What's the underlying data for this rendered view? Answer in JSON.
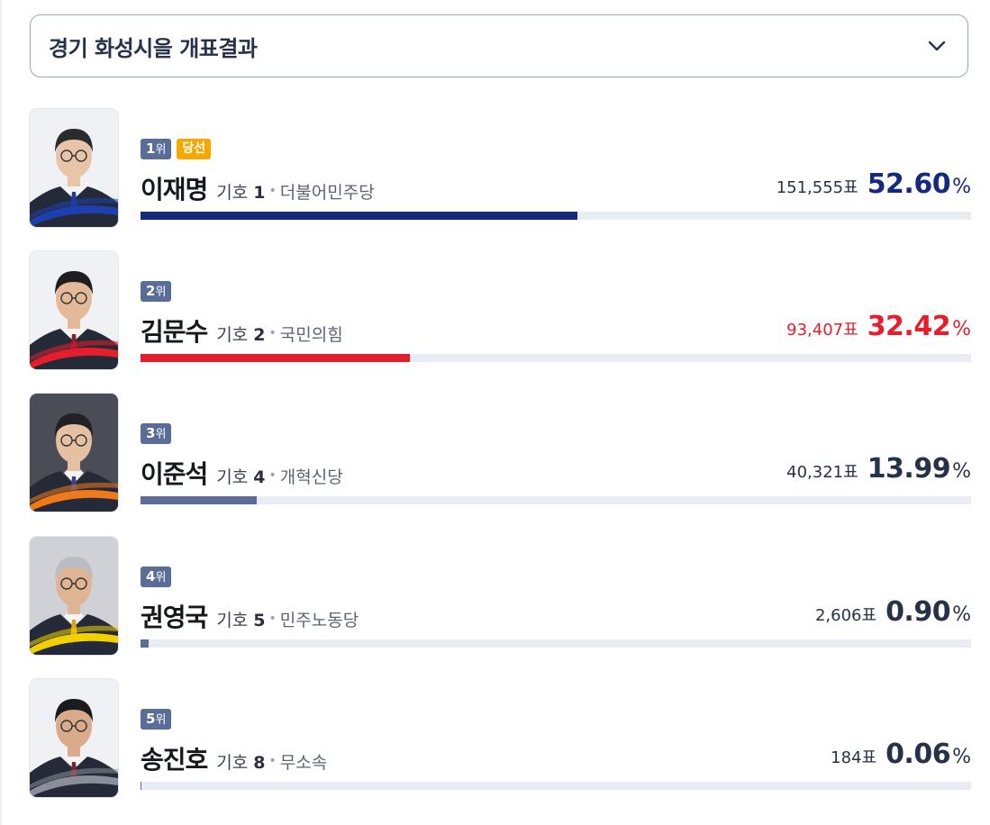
{
  "header": {
    "title": "경기 화성시을 개표결과"
  },
  "candidates": [
    {
      "rank": "1",
      "rank_suffix": "위",
      "elected": "당선",
      "name": "이재명",
      "symbol_label": "기호",
      "symbol": "1",
      "party": "더불어민주당",
      "votes": "151,555",
      "votes_unit": "표",
      "percent": "52.60",
      "percent_sign": "%",
      "share": 0.526,
      "color": "#15297e",
      "stripe": "#1e3fb0"
    },
    {
      "rank": "2",
      "rank_suffix": "위",
      "elected": null,
      "name": "김문수",
      "symbol_label": "기호",
      "symbol": "2",
      "party": "국민의힘",
      "votes": "93,407",
      "votes_unit": "표",
      "percent": "32.42",
      "percent_sign": "%",
      "share": 0.3242,
      "color": "#e61e2b",
      "stripe": "#e61e2b"
    },
    {
      "rank": "3",
      "rank_suffix": "위",
      "elected": null,
      "name": "이준석",
      "symbol_label": "기호",
      "symbol": "4",
      "party": "개혁신당",
      "votes": "40,321",
      "votes_unit": "표",
      "percent": "13.99",
      "percent_sign": "%",
      "share": 0.1399,
      "color": "#5a6d97",
      "stripe": "#f07a1a"
    },
    {
      "rank": "4",
      "rank_suffix": "위",
      "elected": null,
      "name": "권영국",
      "symbol_label": "기호",
      "symbol": "5",
      "party": "민주노동당",
      "votes": "2,606",
      "votes_unit": "표",
      "percent": "0.90",
      "percent_sign": "%",
      "share": 0.009,
      "color": "#5a6d97",
      "stripe": "#f2d100"
    },
    {
      "rank": "5",
      "rank_suffix": "위",
      "elected": null,
      "name": "송진호",
      "symbol_label": "기호",
      "symbol": "8",
      "party": "무소속",
      "votes": "184",
      "votes_unit": "표",
      "percent": "0.06",
      "percent_sign": "%",
      "share": 0.0006,
      "color": "#5a6d97",
      "stripe": "#8a8f99"
    }
  ],
  "colors": {
    "text_default": "#26324a",
    "bar_track": "#e9ecf2"
  },
  "icons": {
    "dropdown": "chevron-down-icon",
    "photo": "candidate-photo"
  }
}
